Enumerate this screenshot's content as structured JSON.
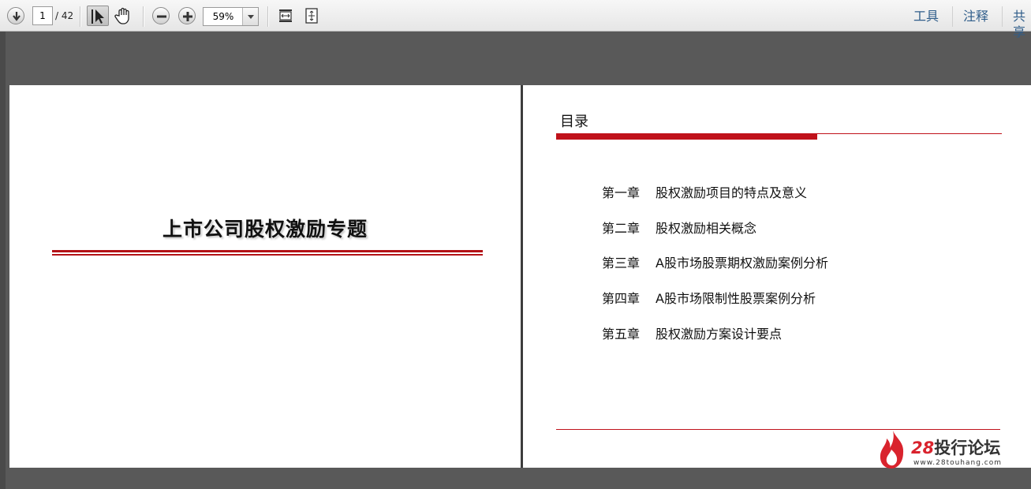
{
  "toolbar": {
    "page_current": "1",
    "page_total": "/ 42",
    "zoom": "59%",
    "right_links": [
      "工具",
      "注释",
      "共享"
    ],
    "icons": [
      "arrow-down-icon",
      "select-arrow-icon",
      "hand-icon",
      "zoom-out-icon",
      "zoom-in-icon",
      "fit-width-icon",
      "fit-page-icon"
    ]
  },
  "document": {
    "cover": {
      "title": "上市公司股权激励专题",
      "accent_color": "#b31217"
    },
    "toc": {
      "heading": "目录",
      "items": [
        {
          "num": "第一章",
          "title": "股权激励项目的特点及意义"
        },
        {
          "num": "第二章",
          "title": "股权激励相关概念"
        },
        {
          "num": "第三章",
          "title": "A股市场股票期权激励案例分析"
        },
        {
          "num": "第四章",
          "title": "A股市场限制性股票案例分析"
        },
        {
          "num": "第五章",
          "title": "股权激励方案设计要点"
        }
      ],
      "accent_color": "#c0121b"
    },
    "watermark": {
      "number": "28",
      "name": "投行论坛",
      "url": "www.28touhang.com"
    }
  }
}
